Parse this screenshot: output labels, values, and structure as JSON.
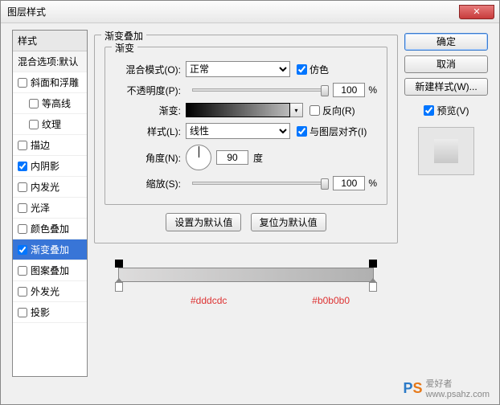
{
  "window": {
    "title": "图层样式",
    "close": "✕"
  },
  "left": {
    "header": "样式",
    "blend": "混合选项:默认",
    "items": [
      {
        "label": "斜面和浮雕",
        "checked": false,
        "indent": false
      },
      {
        "label": "等高线",
        "checked": false,
        "indent": true
      },
      {
        "label": "纹理",
        "checked": false,
        "indent": true
      },
      {
        "label": "描边",
        "checked": false,
        "indent": false
      },
      {
        "label": "内阴影",
        "checked": true,
        "indent": false
      },
      {
        "label": "内发光",
        "checked": false,
        "indent": false
      },
      {
        "label": "光泽",
        "checked": false,
        "indent": false
      },
      {
        "label": "颜色叠加",
        "checked": false,
        "indent": false
      },
      {
        "label": "渐变叠加",
        "checked": true,
        "indent": false,
        "selected": true
      },
      {
        "label": "图案叠加",
        "checked": false,
        "indent": false
      },
      {
        "label": "外发光",
        "checked": false,
        "indent": false
      },
      {
        "label": "投影",
        "checked": false,
        "indent": false
      }
    ]
  },
  "group": {
    "title": "渐变叠加",
    "inner": "渐变",
    "blendMode": {
      "label": "混合模式(O):",
      "value": "正常"
    },
    "dither": {
      "label": "仿色",
      "checked": true
    },
    "opacity": {
      "label": "不透明度(P):",
      "value": "100",
      "unit": "%"
    },
    "gradient": {
      "label": "渐变:"
    },
    "reverse": {
      "label": "反向(R)",
      "checked": false
    },
    "style": {
      "label": "样式(L):",
      "value": "线性"
    },
    "align": {
      "label": "与图层对齐(I)",
      "checked": true
    },
    "angle": {
      "label": "角度(N):",
      "value": "90",
      "unit": "度"
    },
    "scale": {
      "label": "缩放(S):",
      "value": "100",
      "unit": "%"
    },
    "btnDefault": "设置为默认值",
    "btnReset": "复位为默认值"
  },
  "right": {
    "ok": "确定",
    "cancel": "取消",
    "newStyle": "新建样式(W)...",
    "preview": "预览(V)"
  },
  "gradEditor": {
    "color1": "#dddcdc",
    "color2": "#b0b0b0"
  },
  "watermark": {
    "text": "爱好者",
    "url": "www.psahz.com"
  }
}
